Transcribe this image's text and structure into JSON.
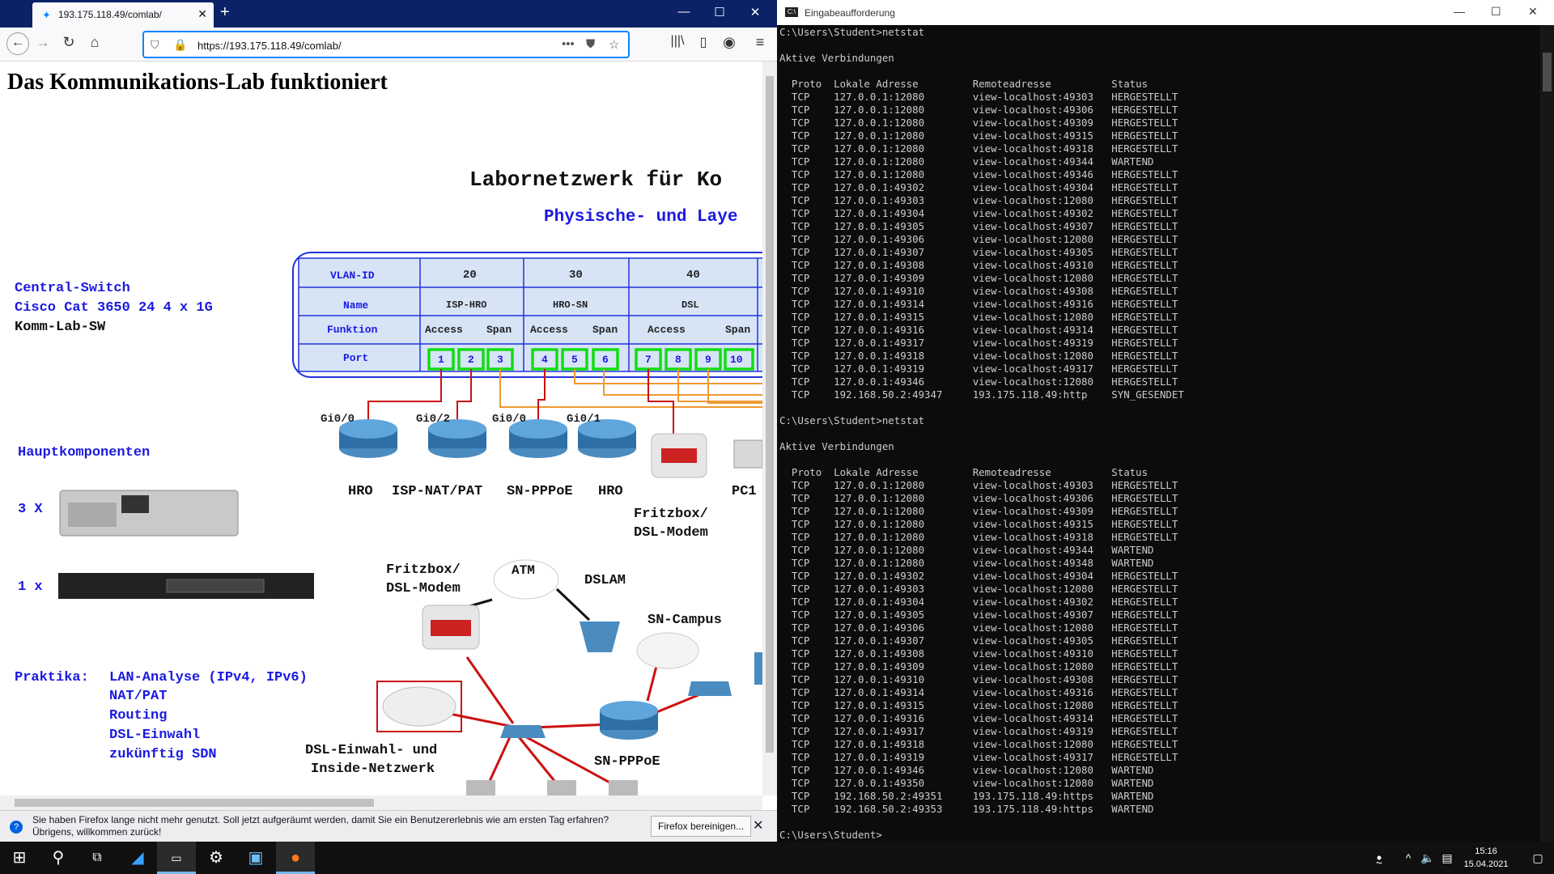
{
  "browser": {
    "tab_title": "193.175.118.49/comlab/",
    "url": "https://193.175.118.49/comlab/",
    "notification": "Sie haben Firefox lange nicht mehr genutzt. Soll jetzt aufgeräumt werden, damit Sie ein Benutzererlebnis wie am ersten Tag erfahren? Übrigens, willkommen zurück!",
    "notification_button": "Firefox bereinigen..."
  },
  "page": {
    "heading": "Das Kommunikations-Lab funktioniert",
    "lab_title": "Labornetzwerk für Ko",
    "lab_subtitle": "Physische- und Laye",
    "switch": {
      "line1": "Central-Switch",
      "line2": "Cisco Cat 3650 24 4 x 1G",
      "line3": "Komm-Lab-SW"
    },
    "table": {
      "h_vlan": "VLAN-ID",
      "h_name": "Name",
      "h_func": "Funktion",
      "h_port": "Port",
      "vlans": [
        "20",
        "30",
        "40"
      ],
      "names": [
        "ISP-HRO",
        "HRO-SN",
        "DSL"
      ],
      "func": [
        "Access",
        "Span",
        "Access",
        "Span",
        "Access",
        "Span"
      ],
      "ports": [
        "1",
        "2",
        "3",
        "4",
        "5",
        "6",
        "7",
        "8",
        "9",
        "10"
      ]
    },
    "ifaces": [
      "Gi0/0",
      "Gi0/2",
      "Gi0/0",
      "Gi0/1"
    ],
    "devices": [
      "HRO",
      "ISP-NAT/PAT",
      "SN-PPPoE",
      "HRO",
      "PC1"
    ],
    "fritz1": [
      "Fritzbox/",
      "DSL-Modem"
    ],
    "main_components": "Hauptkomponenten",
    "count1": "3 X",
    "count2": "1 x",
    "fritz2": [
      "Fritzbox/",
      "DSL-Modem"
    ],
    "atm": "ATM",
    "dslam": "DSLAM",
    "sn_campus": "SN-Campus",
    "dsl_inside": [
      "DSL-Einwahl- und",
      "Inside-Netzwerk"
    ],
    "sn_pppoe": "SN-PPPoE",
    "praktika_label": "Praktika:",
    "praktika": [
      "LAN-Analyse (IPv4, IPv6)",
      "NAT/PAT",
      "Routing",
      "DSL-Einwahl",
      "zukünftig SDN"
    ]
  },
  "cmd": {
    "title": "Eingabeaufforderung",
    "text": "C:\\Users\\Student>netstat\n\nAktive Verbindungen\n\n  Proto  Lokale Adresse         Remoteadresse          Status\n  TCP    127.0.0.1:12080        view-localhost:49303   HERGESTELLT\n  TCP    127.0.0.1:12080        view-localhost:49306   HERGESTELLT\n  TCP    127.0.0.1:12080        view-localhost:49309   HERGESTELLT\n  TCP    127.0.0.1:12080        view-localhost:49315   HERGESTELLT\n  TCP    127.0.0.1:12080        view-localhost:49318   HERGESTELLT\n  TCP    127.0.0.1:12080        view-localhost:49344   WARTEND\n  TCP    127.0.0.1:12080        view-localhost:49346   HERGESTELLT\n  TCP    127.0.0.1:49302        view-localhost:49304   HERGESTELLT\n  TCP    127.0.0.1:49303        view-localhost:12080   HERGESTELLT\n  TCP    127.0.0.1:49304        view-localhost:49302   HERGESTELLT\n  TCP    127.0.0.1:49305        view-localhost:49307   HERGESTELLT\n  TCP    127.0.0.1:49306        view-localhost:12080   HERGESTELLT\n  TCP    127.0.0.1:49307        view-localhost:49305   HERGESTELLT\n  TCP    127.0.0.1:49308        view-localhost:49310   HERGESTELLT\n  TCP    127.0.0.1:49309        view-localhost:12080   HERGESTELLT\n  TCP    127.0.0.1:49310        view-localhost:49308   HERGESTELLT\n  TCP    127.0.0.1:49314        view-localhost:49316   HERGESTELLT\n  TCP    127.0.0.1:49315        view-localhost:12080   HERGESTELLT\n  TCP    127.0.0.1:49316        view-localhost:49314   HERGESTELLT\n  TCP    127.0.0.1:49317        view-localhost:49319   HERGESTELLT\n  TCP    127.0.0.1:49318        view-localhost:12080   HERGESTELLT\n  TCP    127.0.0.1:49319        view-localhost:49317   HERGESTELLT\n  TCP    127.0.0.1:49346        view-localhost:12080   HERGESTELLT\n  TCP    192.168.50.2:49347     193.175.118.49:http    SYN_GESENDET\n\nC:\\Users\\Student>netstat\n\nAktive Verbindungen\n\n  Proto  Lokale Adresse         Remoteadresse          Status\n  TCP    127.0.0.1:12080        view-localhost:49303   HERGESTELLT\n  TCP    127.0.0.1:12080        view-localhost:49306   HERGESTELLT\n  TCP    127.0.0.1:12080        view-localhost:49309   HERGESTELLT\n  TCP    127.0.0.1:12080        view-localhost:49315   HERGESTELLT\n  TCP    127.0.0.1:12080        view-localhost:49318   HERGESTELLT\n  TCP    127.0.0.1:12080        view-localhost:49344   WARTEND\n  TCP    127.0.0.1:12080        view-localhost:49348   WARTEND\n  TCP    127.0.0.1:49302        view-localhost:49304   HERGESTELLT\n  TCP    127.0.0.1:49303        view-localhost:12080   HERGESTELLT\n  TCP    127.0.0.1:49304        view-localhost:49302   HERGESTELLT\n  TCP    127.0.0.1:49305        view-localhost:49307   HERGESTELLT\n  TCP    127.0.0.1:49306        view-localhost:12080   HERGESTELLT\n  TCP    127.0.0.1:49307        view-localhost:49305   HERGESTELLT\n  TCP    127.0.0.1:49308        view-localhost:49310   HERGESTELLT\n  TCP    127.0.0.1:49309        view-localhost:12080   HERGESTELLT\n  TCP    127.0.0.1:49310        view-localhost:49308   HERGESTELLT\n  TCP    127.0.0.1:49314        view-localhost:49316   HERGESTELLT\n  TCP    127.0.0.1:49315        view-localhost:12080   HERGESTELLT\n  TCP    127.0.0.1:49316        view-localhost:49314   HERGESTELLT\n  TCP    127.0.0.1:49317        view-localhost:49319   HERGESTELLT\n  TCP    127.0.0.1:49318        view-localhost:12080   HERGESTELLT\n  TCP    127.0.0.1:49319        view-localhost:49317   HERGESTELLT\n  TCP    127.0.0.1:49346        view-localhost:12080   WARTEND\n  TCP    127.0.0.1:49350        view-localhost:12080   WARTEND\n  TCP    192.168.50.2:49351     193.175.118.49:https   WARTEND\n  TCP    192.168.50.2:49353     193.175.118.49:https   WARTEND\n\nC:\\Users\\Student>"
  },
  "taskbar": {
    "time": "15:16",
    "date": "15.04.2021"
  }
}
